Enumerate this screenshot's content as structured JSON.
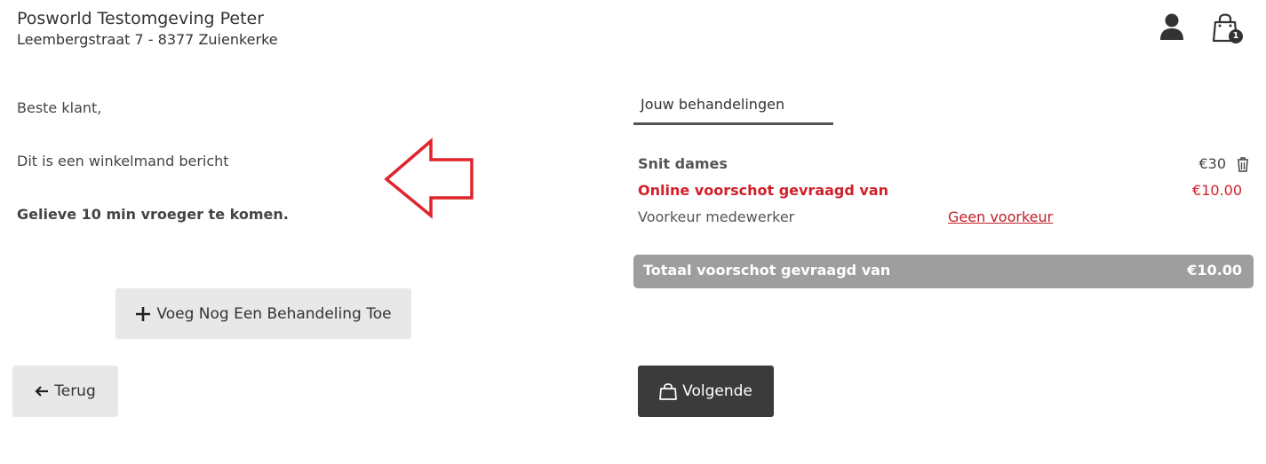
{
  "header": {
    "shop_name": "Posworld Testomgeving Peter",
    "shop_address": "Leembergstraat 7 - 8377 Zuienkerke",
    "cart_count": "1",
    "icons": {
      "user": "user-icon",
      "cart": "shopping-bag-icon"
    }
  },
  "message": {
    "greeting": "Beste klant,",
    "body": "Dit is een winkelmand bericht",
    "note": "Gelieve 10 min vroeger te komen."
  },
  "annotation": {
    "icon": "left-arrow-annotation",
    "color": "#e0242c"
  },
  "buttons": {
    "add_treatment": "Voeg Nog Een Behandeling Toe",
    "back": "Terug",
    "next": "Volgende"
  },
  "cart": {
    "tab_label": "Jouw behandelingen",
    "item": {
      "name": "Snit dames",
      "price": "€30",
      "deposit_label": "Online voorschot gevraagd van",
      "deposit_value": "€10.00",
      "preference_label": "Voorkeur medewerker",
      "preference_value": "Geen voorkeur"
    },
    "total_label": "Totaal voorschot gevraagd van",
    "total_value": "€10.00"
  },
  "colors": {
    "accent_red": "#d0202a",
    "dark_button": "#3b3b3b",
    "total_bar": "#9e9e9e"
  }
}
